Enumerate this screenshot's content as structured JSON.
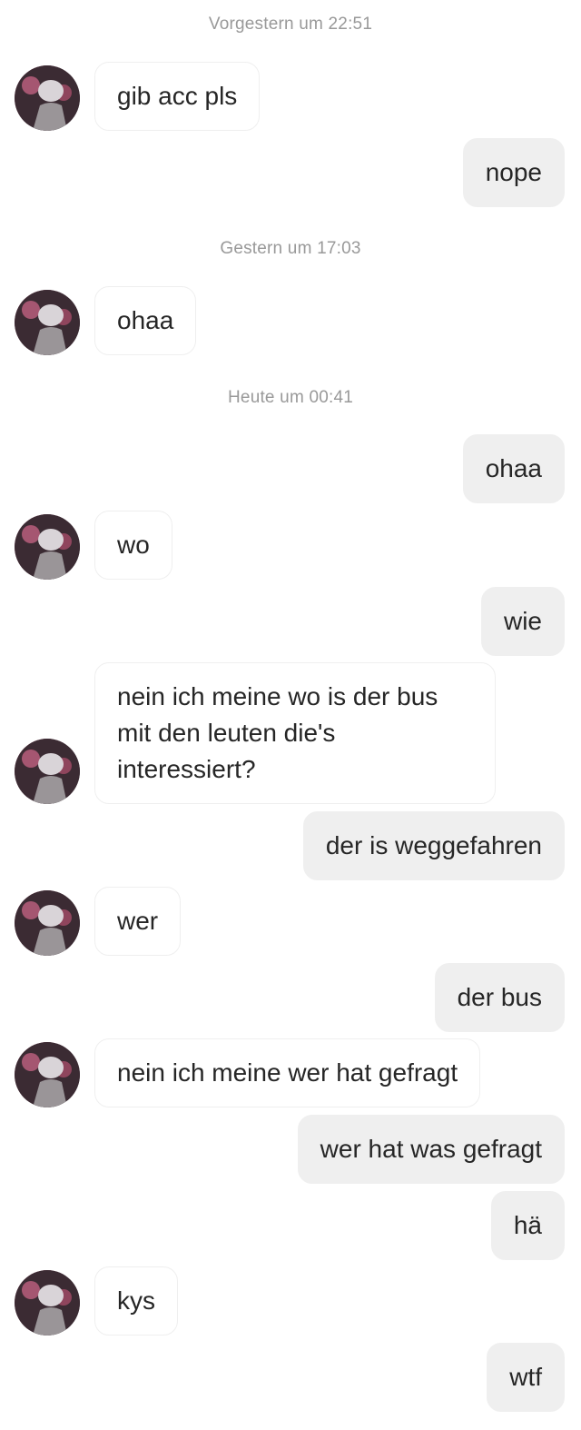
{
  "conversation": {
    "timestamps": {
      "t1": "Vorgestern um 22:51",
      "t2": "Gestern um 17:03",
      "t3": "Heute um 00:41"
    },
    "messages": [
      {
        "from": "them",
        "text": "gib acc pls"
      },
      {
        "from": "me",
        "text": "nope"
      },
      {
        "from": "them",
        "text": "ohaa"
      },
      {
        "from": "me",
        "text": "ohaa"
      },
      {
        "from": "them",
        "text": "wo"
      },
      {
        "from": "me",
        "text": "wie"
      },
      {
        "from": "them",
        "text": "nein ich meine wo is der bus mit den leuten die's interessiert?"
      },
      {
        "from": "me",
        "text": "der is weggefahren"
      },
      {
        "from": "them",
        "text": "wer"
      },
      {
        "from": "me",
        "text": "der bus"
      },
      {
        "from": "them",
        "text": "nein ich meine wer hat gefragt"
      },
      {
        "from": "me",
        "text": "wer hat was gefragt"
      },
      {
        "from": "me",
        "text": "hä"
      },
      {
        "from": "them",
        "text": "kys"
      },
      {
        "from": "me",
        "text": "wtf"
      }
    ]
  },
  "colors": {
    "incoming_bubble_bg": "#ffffff",
    "incoming_bubble_border": "#efefef",
    "outgoing_bubble_bg": "#efefef",
    "timestamp_text": "#999999",
    "message_text": "#262626"
  },
  "icons": {
    "avatar": "user-profile-photo"
  }
}
